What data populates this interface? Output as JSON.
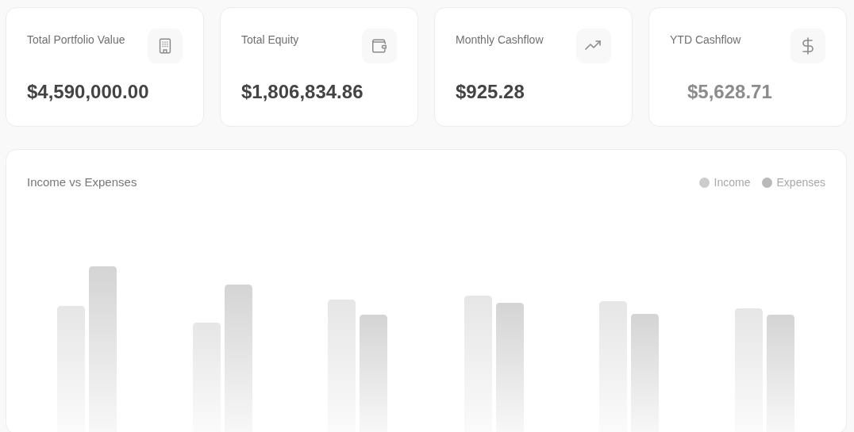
{
  "stat_cards": [
    {
      "label": "Total Portfolio Value",
      "value": "$4,590,000.00",
      "dimmed": false
    },
    {
      "label": "Total Equity",
      "value": "$1,806,834.86",
      "dimmed": false
    },
    {
      "label": "Monthly Cashflow",
      "value": "$925.28",
      "dimmed": false
    },
    {
      "label": "YTD Cashflow",
      "value": "$5,628.71",
      "dimmed": true
    }
  ],
  "chart_panel": {
    "title": "Income vs Expenses",
    "legend": [
      {
        "label": "Income",
        "color": "#cccccc"
      },
      {
        "label": "Expenses",
        "color": "#b9b9b9"
      }
    ]
  }
}
